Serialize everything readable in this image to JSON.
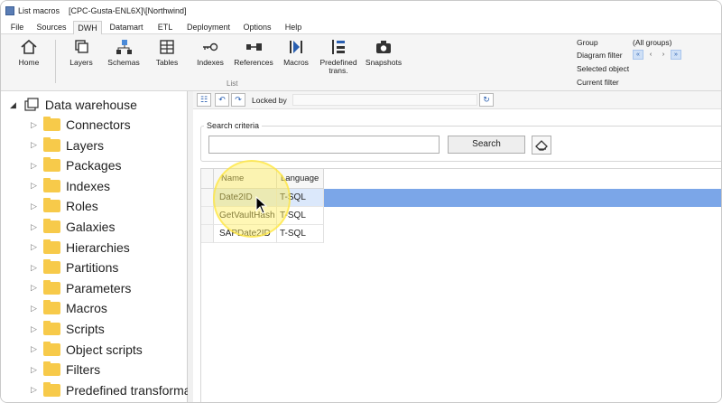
{
  "window": {
    "title": "List macros",
    "context": "[CPC-Gusta-ENL6X]\\[Northwind]"
  },
  "menu": {
    "tabs": [
      "File",
      "Sources",
      "DWH",
      "Datamart",
      "ETL",
      "Deployment",
      "Options",
      "Help"
    ],
    "active": "DWH"
  },
  "ribbon": {
    "home": "Home",
    "layers": "Layers",
    "schemas": "Schemas",
    "tables": "Tables",
    "indexes": "Indexes",
    "references": "References",
    "macros": "Macros",
    "predefined": "Predefined trans.",
    "snapshots": "Snapshots",
    "group_label": "List",
    "filters": {
      "group_label": "Group",
      "group_value": "(All groups)",
      "diagram_label": "Diagram filter",
      "selected_label": "Selected object",
      "current_label": "Current filter"
    }
  },
  "tree": {
    "root": "Data warehouse",
    "items": [
      "Connectors",
      "Layers",
      "Packages",
      "Indexes",
      "Roles",
      "Galaxies",
      "Hierarchies",
      "Partitions",
      "Parameters",
      "Macros",
      "Scripts",
      "Object scripts",
      "Filters",
      "Predefined transforma"
    ]
  },
  "toolbar": {
    "locked_by": "Locked by"
  },
  "search": {
    "legend": "Search criteria",
    "value": "",
    "button": "Search"
  },
  "grid": {
    "columns": [
      "Name",
      "Language"
    ],
    "rows": [
      {
        "name": "Date2ID",
        "language": "T-SQL",
        "selected": true
      },
      {
        "name": "GetVaultHash",
        "language": "T-SQL",
        "selected": false
      },
      {
        "name": "SAPDate2ID",
        "language": "T-SQL",
        "selected": false
      }
    ]
  },
  "colors": {
    "accent": "#7ba6e8",
    "folder": "#f7ca4a",
    "highlight": "#ffee5a"
  }
}
